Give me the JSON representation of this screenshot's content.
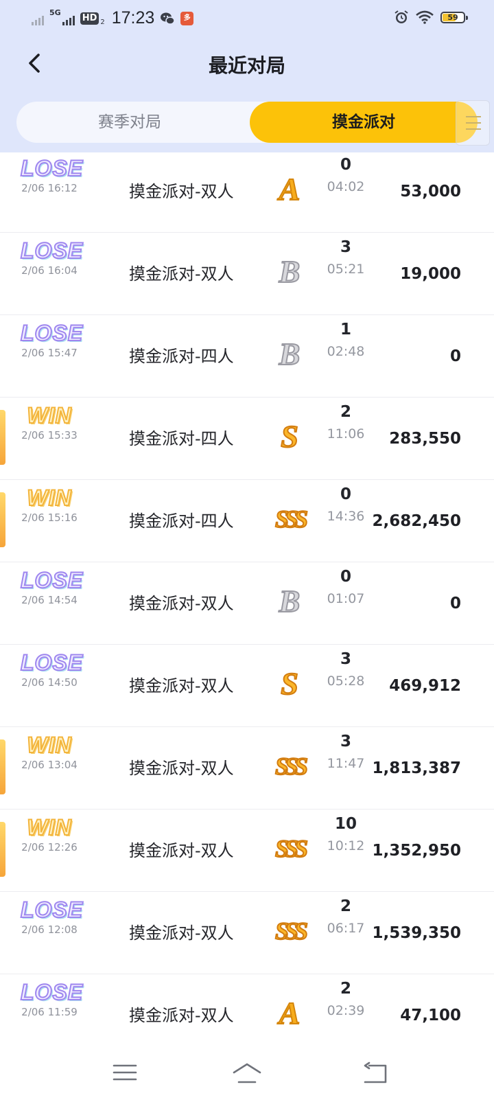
{
  "status_bar": {
    "network": "5G",
    "hd": "HD",
    "hd_sub": "2",
    "time": "17:23",
    "app_badge": "多",
    "battery": "59"
  },
  "header": {
    "title": "最近对局",
    "back_icon": "chevron-left-icon"
  },
  "tabs": [
    {
      "label": "赛季对局",
      "active": false
    },
    {
      "label": "摸金派对",
      "active": true
    }
  ],
  "matches": [
    {
      "result": "LOSE",
      "time": "2/06 16:12",
      "mode": "摸金派对-双人",
      "grade": "A",
      "count": "0",
      "duration": "04:02",
      "score": "53,000"
    },
    {
      "result": "LOSE",
      "time": "2/06 16:04",
      "mode": "摸金派对-双人",
      "grade": "B",
      "count": "3",
      "duration": "05:21",
      "score": "19,000"
    },
    {
      "result": "LOSE",
      "time": "2/06 15:47",
      "mode": "摸金派对-四人",
      "grade": "B",
      "count": "1",
      "duration": "02:48",
      "score": "0"
    },
    {
      "result": "WIN",
      "time": "2/06 15:33",
      "mode": "摸金派对-四人",
      "grade": "S",
      "count": "2",
      "duration": "11:06",
      "score": "283,550"
    },
    {
      "result": "WIN",
      "time": "2/06 15:16",
      "mode": "摸金派对-四人",
      "grade": "SSS",
      "count": "0",
      "duration": "14:36",
      "score": "2,682,450"
    },
    {
      "result": "LOSE",
      "time": "2/06 14:54",
      "mode": "摸金派对-双人",
      "grade": "B",
      "count": "0",
      "duration": "01:07",
      "score": "0"
    },
    {
      "result": "LOSE",
      "time": "2/06 14:50",
      "mode": "摸金派对-双人",
      "grade": "S",
      "count": "3",
      "duration": "05:28",
      "score": "469,912"
    },
    {
      "result": "WIN",
      "time": "2/06 13:04",
      "mode": "摸金派对-双人",
      "grade": "SSS",
      "count": "3",
      "duration": "11:47",
      "score": "1,813,387"
    },
    {
      "result": "WIN",
      "time": "2/06 12:26",
      "mode": "摸金派对-双人",
      "grade": "SSS",
      "count": "10",
      "duration": "10:12",
      "score": "1,352,950"
    },
    {
      "result": "LOSE",
      "time": "2/06 12:08",
      "mode": "摸金派对-双人",
      "grade": "SSS",
      "count": "2",
      "duration": "06:17",
      "score": "1,539,350"
    },
    {
      "result": "LOSE",
      "time": "2/06 11:59",
      "mode": "摸金派对-双人",
      "grade": "A",
      "count": "2",
      "duration": "02:39",
      "score": "47,100"
    }
  ],
  "nav_bar": {
    "icons": [
      "menu-icon",
      "home-icon",
      "back-icon"
    ]
  },
  "colors": {
    "header_bg": "#dfe6fb",
    "active_tab": "#fcc209",
    "lose_badge": "#9e86ef",
    "win_badge": "#f3b43b",
    "grade_gold": "#fbb62a",
    "grade_silver": "#9a9aa2"
  }
}
